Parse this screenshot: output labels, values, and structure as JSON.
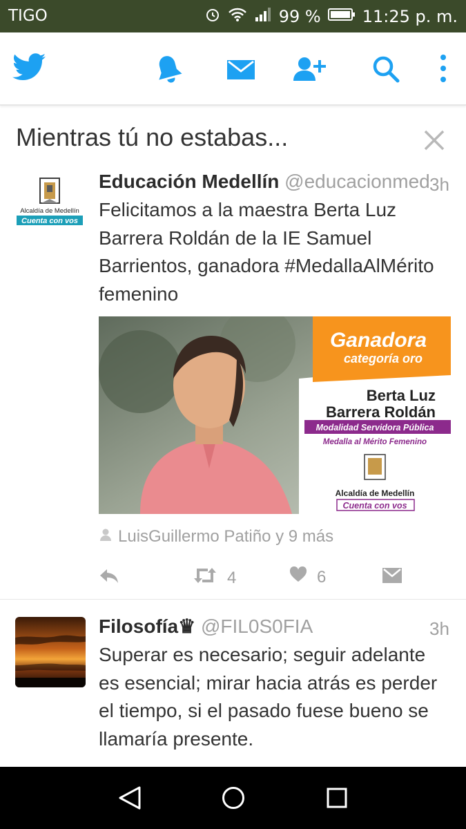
{
  "status_bar": {
    "carrier": "TIGO",
    "battery": "99 %",
    "time": "11:25 p. m."
  },
  "navbar": {
    "icons": [
      "twitter-bird-icon",
      "bell-icon",
      "mail-icon",
      "add-user-icon",
      "search-icon",
      "more-vertical-icon"
    ]
  },
  "section": {
    "title": "Mientras tú no estabas..."
  },
  "tweets": [
    {
      "name": "Educación Medellín",
      "handle": "@educacionmed",
      "time": "3h",
      "text": "Felicitamos a la maestra Berta Luz Barrera Roldán de la IE Samuel Barrientos, ganadora #MedallaAlMérito femenino",
      "avatar": {
        "line1": "Alcaldía de Medellín",
        "line2": "Cuenta con vos"
      },
      "media": {
        "banner_title": "Ganadora",
        "banner_subtitle": "categoría oro",
        "person_name_1": "Berta Luz",
        "person_name_2": "Barrera Roldán",
        "modalidad": "Modalidad Servidora Pública",
        "medalla": "Medalla al Mérito Femenino",
        "logo_line1": "Alcaldía de Medellín",
        "logo_line2": "Cuenta con vos"
      },
      "retweeted_by": "LuisGuillermo Patiño y 9 más",
      "retweets": "4",
      "likes": "6"
    },
    {
      "name": "Filosofía♛",
      "handle": "@FIL0S0FIA",
      "time": "3h",
      "text": "Superar es necesario; seguir adelante es esencial; mirar hacia atrás es perder el tiempo, si el pasado fuese bueno se llamaría presente."
    }
  ],
  "colors": {
    "twitter_blue": "#1da1f2",
    "orange": "#f7941d",
    "purple": "#8c2a8c"
  }
}
